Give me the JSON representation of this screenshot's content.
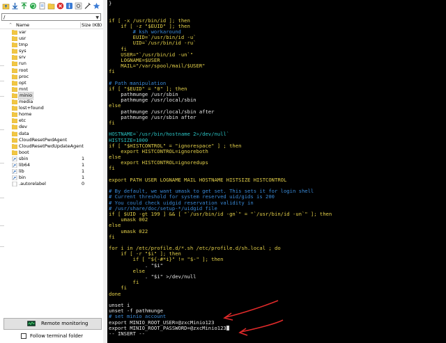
{
  "toolbar": {
    "icons": [
      "up-folder-icon",
      "download-icon",
      "upload-icon",
      "refresh-icon",
      "new-file-icon",
      "new-folder-icon",
      "delete-icon",
      "info-icon",
      "settings-icon",
      "terminal-icon",
      "favorites-icon"
    ]
  },
  "path": "/",
  "columns": {
    "name": "Name",
    "size": "Size (KB)"
  },
  "files": [
    {
      "name": "var",
      "size": "",
      "type": "folder"
    },
    {
      "name": "usr",
      "size": "",
      "type": "folder"
    },
    {
      "name": "tmp",
      "size": "",
      "type": "folder"
    },
    {
      "name": "sys",
      "size": "",
      "type": "folder"
    },
    {
      "name": "srv",
      "size": "",
      "type": "folder"
    },
    {
      "name": "run",
      "size": "",
      "type": "folder"
    },
    {
      "name": "root",
      "size": "",
      "type": "folder"
    },
    {
      "name": "proc",
      "size": "",
      "type": "folder"
    },
    {
      "name": "opt",
      "size": "",
      "type": "folder"
    },
    {
      "name": "mnt",
      "size": "",
      "type": "folder"
    },
    {
      "name": "minio",
      "size": "",
      "type": "folder",
      "selected": true
    },
    {
      "name": "media",
      "size": "",
      "type": "folder"
    },
    {
      "name": "lost+found",
      "size": "",
      "type": "folder"
    },
    {
      "name": "home",
      "size": "",
      "type": "folder"
    },
    {
      "name": "etc",
      "size": "",
      "type": "folder"
    },
    {
      "name": "dev",
      "size": "",
      "type": "folder"
    },
    {
      "name": "data",
      "size": "",
      "type": "folder"
    },
    {
      "name": "CloudResetPwdAgent",
      "size": "",
      "type": "folder"
    },
    {
      "name": "CloudResetPwdUpdateAgent",
      "size": "",
      "type": "folder"
    },
    {
      "name": "boot",
      "size": "",
      "type": "folder"
    },
    {
      "name": "sbin",
      "size": "1",
      "type": "link"
    },
    {
      "name": "lib64",
      "size": "1",
      "type": "link"
    },
    {
      "name": "lib",
      "size": "1",
      "type": "link"
    },
    {
      "name": "bin",
      "size": "1",
      "type": "link"
    },
    {
      "name": ".autorelabel",
      "size": "0",
      "type": "file"
    }
  ],
  "remote_monitoring_label": "Remote monitoring",
  "follow_terminal_label": "Follow terminal folder",
  "terminal": {
    "lines": [
      [
        {
          "t": "}",
          "c": "w"
        }
      ],
      [],
      [],
      [
        {
          "t": "if [ -x /usr/bin/id ]; then",
          "c": "y"
        }
      ],
      [
        {
          "t": "    if [ -z \"$EUID\" ]; then",
          "c": "y"
        }
      ],
      [
        {
          "t": "        # ksh workaround",
          "c": "c"
        }
      ],
      [
        {
          "t": "        EUID=`/usr/bin/id -u`",
          "c": "y"
        }
      ],
      [
        {
          "t": "        UID=`/usr/bin/id -ru`",
          "c": "y"
        }
      ],
      [
        {
          "t": "    fi",
          "c": "y"
        }
      ],
      [
        {
          "t": "    USER=\"`/usr/bin/id -un`\"",
          "c": "y"
        }
      ],
      [
        {
          "t": "    LOGNAME=$USER",
          "c": "y"
        }
      ],
      [
        {
          "t": "    MAIL=\"/var/spool/mail/$USER\"",
          "c": "y"
        }
      ],
      [
        {
          "t": "fi",
          "c": "y"
        }
      ],
      [],
      [
        {
          "t": "# Path manipulation",
          "c": "c"
        }
      ],
      [
        {
          "t": "if [ \"$EUID\" = \"0\" ]; then",
          "c": "y"
        }
      ],
      [
        {
          "t": "    pathmunge /usr/sbin",
          "c": "w"
        }
      ],
      [
        {
          "t": "    pathmunge /usr/local/sbin",
          "c": "w"
        }
      ],
      [
        {
          "t": "else",
          "c": "y"
        }
      ],
      [
        {
          "t": "    pathmunge /usr/local/sbin after",
          "c": "w"
        }
      ],
      [
        {
          "t": "    pathmunge /usr/sbin after",
          "c": "w"
        }
      ],
      [
        {
          "t": "fi",
          "c": "y"
        }
      ],
      [],
      [
        {
          "t": "HOSTNAME=`/usr/bin/hostname 2>/dev/null`",
          "c": "g"
        }
      ],
      [
        {
          "t": "HISTSIZE=1000",
          "c": "g"
        }
      ],
      [
        {
          "t": "if [ \"$HISTCONTROL\" = \"ignorespace\" ] ; then",
          "c": "y"
        }
      ],
      [
        {
          "t": "    export HISTCONTROL=ignoreboth",
          "c": "y"
        }
      ],
      [
        {
          "t": "else",
          "c": "y"
        }
      ],
      [
        {
          "t": "    export HISTCONTROL=ignoredups",
          "c": "y"
        }
      ],
      [
        {
          "t": "fi",
          "c": "y"
        }
      ],
      [],
      [
        {
          "t": "export PATH USER LOGNAME MAIL HOSTNAME HISTSIZE HISTCONTROL",
          "c": "y"
        }
      ],
      [],
      [
        {
          "t": "# By default, we want umask to get set. This sets it for login shell",
          "c": "c"
        }
      ],
      [
        {
          "t": "# Current threshold for system reserved uid/gids is 200",
          "c": "c"
        }
      ],
      [
        {
          "t": "# You could check uidgid reservation validity in",
          "c": "c"
        }
      ],
      [
        {
          "t": "# /usr/share/doc/setup-*/uidgid file",
          "c": "c"
        }
      ],
      [
        {
          "t": "if [ $UID -gt 199 ] && [ \"`/usr/bin/id -gn`\" = \"`/usr/bin/id -un`\" ]; then",
          "c": "y"
        }
      ],
      [
        {
          "t": "    umask 002",
          "c": "y"
        }
      ],
      [
        {
          "t": "else",
          "c": "y"
        }
      ],
      [
        {
          "t": "    umask 022",
          "c": "y"
        }
      ],
      [
        {
          "t": "fi",
          "c": "y"
        }
      ],
      [],
      [
        {
          "t": "for i in /etc/profile.d/*.sh /etc/profile.d/sh.local ; do",
          "c": "y"
        }
      ],
      [
        {
          "t": "    if [ -r \"$i\" ]; then",
          "c": "y"
        }
      ],
      [
        {
          "t": "        if [ \"${-#*i}\" != \"$-\" ]; then",
          "c": "y"
        }
      ],
      [
        {
          "t": "            . \"$i\"",
          "c": "w"
        }
      ],
      [
        {
          "t": "        else",
          "c": "y"
        }
      ],
      [
        {
          "t": "            . \"$i\" >/dev/null",
          "c": "w"
        }
      ],
      [
        {
          "t": "        fi",
          "c": "y"
        }
      ],
      [
        {
          "t": "    fi",
          "c": "y"
        }
      ],
      [
        {
          "t": "done",
          "c": "y"
        }
      ],
      [],
      [
        {
          "t": "unset i",
          "c": "w"
        }
      ],
      [
        {
          "t": "unset -f pathmunge",
          "c": "w"
        }
      ],
      [
        {
          "t": "# set minio account",
          "c": "c"
        }
      ],
      [
        {
          "t": "export MINIO_ROOT_USER=@zxcMinio123",
          "c": "w"
        }
      ],
      [
        {
          "t": "export MINIO_ROOT_PASSWORD=@zxcMinio123",
          "c": "w"
        }
      ],
      [
        {
          "t": "-- INSERT --",
          "c": "w"
        }
      ]
    ]
  },
  "colors": {
    "terminal_bg": "#000000",
    "keyword": "#e6d24a",
    "comment": "#3a8ad8",
    "variable": "#2bc4c4",
    "annotation_arrow": "#e02a2a",
    "folder": "#f2c744"
  }
}
